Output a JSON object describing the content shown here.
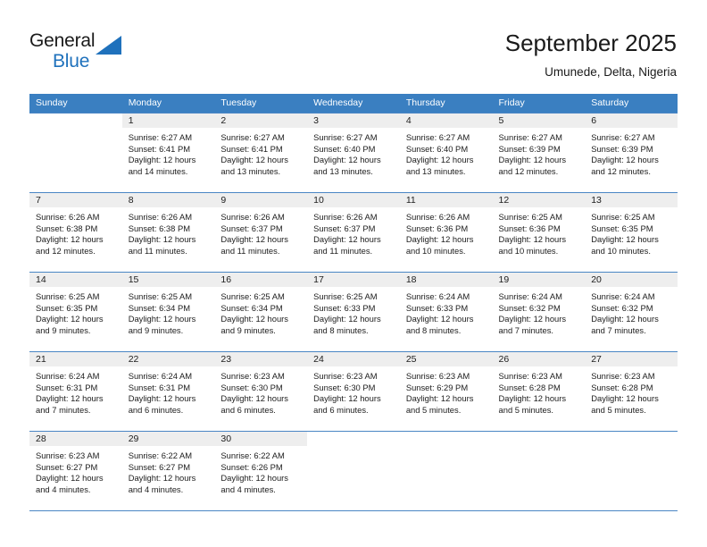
{
  "brand": {
    "name_dark": "General",
    "name_blue": "Blue",
    "accent_color": "#1f71bc"
  },
  "header": {
    "title": "September 2025",
    "subtitle": "Umunede, Delta, Nigeria"
  },
  "theme": {
    "header_band": "#3a7fc1",
    "row_rule": "#4a86c4",
    "daynum_band": "#eeeeee",
    "text": "#202020"
  },
  "weekdays": [
    "Sunday",
    "Monday",
    "Tuesday",
    "Wednesday",
    "Thursday",
    "Friday",
    "Saturday"
  ],
  "weeks": [
    [
      {
        "day": "",
        "sunrise": "",
        "sunset": "",
        "daylight1": "",
        "daylight2": ""
      },
      {
        "day": "1",
        "sunrise": "Sunrise: 6:27 AM",
        "sunset": "Sunset: 6:41 PM",
        "daylight1": "Daylight: 12 hours",
        "daylight2": "and 14 minutes."
      },
      {
        "day": "2",
        "sunrise": "Sunrise: 6:27 AM",
        "sunset": "Sunset: 6:41 PM",
        "daylight1": "Daylight: 12 hours",
        "daylight2": "and 13 minutes."
      },
      {
        "day": "3",
        "sunrise": "Sunrise: 6:27 AM",
        "sunset": "Sunset: 6:40 PM",
        "daylight1": "Daylight: 12 hours",
        "daylight2": "and 13 minutes."
      },
      {
        "day": "4",
        "sunrise": "Sunrise: 6:27 AM",
        "sunset": "Sunset: 6:40 PM",
        "daylight1": "Daylight: 12 hours",
        "daylight2": "and 13 minutes."
      },
      {
        "day": "5",
        "sunrise": "Sunrise: 6:27 AM",
        "sunset": "Sunset: 6:39 PM",
        "daylight1": "Daylight: 12 hours",
        "daylight2": "and 12 minutes."
      },
      {
        "day": "6",
        "sunrise": "Sunrise: 6:27 AM",
        "sunset": "Sunset: 6:39 PM",
        "daylight1": "Daylight: 12 hours",
        "daylight2": "and 12 minutes."
      }
    ],
    [
      {
        "day": "7",
        "sunrise": "Sunrise: 6:26 AM",
        "sunset": "Sunset: 6:38 PM",
        "daylight1": "Daylight: 12 hours",
        "daylight2": "and 12 minutes."
      },
      {
        "day": "8",
        "sunrise": "Sunrise: 6:26 AM",
        "sunset": "Sunset: 6:38 PM",
        "daylight1": "Daylight: 12 hours",
        "daylight2": "and 11 minutes."
      },
      {
        "day": "9",
        "sunrise": "Sunrise: 6:26 AM",
        "sunset": "Sunset: 6:37 PM",
        "daylight1": "Daylight: 12 hours",
        "daylight2": "and 11 minutes."
      },
      {
        "day": "10",
        "sunrise": "Sunrise: 6:26 AM",
        "sunset": "Sunset: 6:37 PM",
        "daylight1": "Daylight: 12 hours",
        "daylight2": "and 11 minutes."
      },
      {
        "day": "11",
        "sunrise": "Sunrise: 6:26 AM",
        "sunset": "Sunset: 6:36 PM",
        "daylight1": "Daylight: 12 hours",
        "daylight2": "and 10 minutes."
      },
      {
        "day": "12",
        "sunrise": "Sunrise: 6:25 AM",
        "sunset": "Sunset: 6:36 PM",
        "daylight1": "Daylight: 12 hours",
        "daylight2": "and 10 minutes."
      },
      {
        "day": "13",
        "sunrise": "Sunrise: 6:25 AM",
        "sunset": "Sunset: 6:35 PM",
        "daylight1": "Daylight: 12 hours",
        "daylight2": "and 10 minutes."
      }
    ],
    [
      {
        "day": "14",
        "sunrise": "Sunrise: 6:25 AM",
        "sunset": "Sunset: 6:35 PM",
        "daylight1": "Daylight: 12 hours",
        "daylight2": "and 9 minutes."
      },
      {
        "day": "15",
        "sunrise": "Sunrise: 6:25 AM",
        "sunset": "Sunset: 6:34 PM",
        "daylight1": "Daylight: 12 hours",
        "daylight2": "and 9 minutes."
      },
      {
        "day": "16",
        "sunrise": "Sunrise: 6:25 AM",
        "sunset": "Sunset: 6:34 PM",
        "daylight1": "Daylight: 12 hours",
        "daylight2": "and 9 minutes."
      },
      {
        "day": "17",
        "sunrise": "Sunrise: 6:25 AM",
        "sunset": "Sunset: 6:33 PM",
        "daylight1": "Daylight: 12 hours",
        "daylight2": "and 8 minutes."
      },
      {
        "day": "18",
        "sunrise": "Sunrise: 6:24 AM",
        "sunset": "Sunset: 6:33 PM",
        "daylight1": "Daylight: 12 hours",
        "daylight2": "and 8 minutes."
      },
      {
        "day": "19",
        "sunrise": "Sunrise: 6:24 AM",
        "sunset": "Sunset: 6:32 PM",
        "daylight1": "Daylight: 12 hours",
        "daylight2": "and 7 minutes."
      },
      {
        "day": "20",
        "sunrise": "Sunrise: 6:24 AM",
        "sunset": "Sunset: 6:32 PM",
        "daylight1": "Daylight: 12 hours",
        "daylight2": "and 7 minutes."
      }
    ],
    [
      {
        "day": "21",
        "sunrise": "Sunrise: 6:24 AM",
        "sunset": "Sunset: 6:31 PM",
        "daylight1": "Daylight: 12 hours",
        "daylight2": "and 7 minutes."
      },
      {
        "day": "22",
        "sunrise": "Sunrise: 6:24 AM",
        "sunset": "Sunset: 6:31 PM",
        "daylight1": "Daylight: 12 hours",
        "daylight2": "and 6 minutes."
      },
      {
        "day": "23",
        "sunrise": "Sunrise: 6:23 AM",
        "sunset": "Sunset: 6:30 PM",
        "daylight1": "Daylight: 12 hours",
        "daylight2": "and 6 minutes."
      },
      {
        "day": "24",
        "sunrise": "Sunrise: 6:23 AM",
        "sunset": "Sunset: 6:30 PM",
        "daylight1": "Daylight: 12 hours",
        "daylight2": "and 6 minutes."
      },
      {
        "day": "25",
        "sunrise": "Sunrise: 6:23 AM",
        "sunset": "Sunset: 6:29 PM",
        "daylight1": "Daylight: 12 hours",
        "daylight2": "and 5 minutes."
      },
      {
        "day": "26",
        "sunrise": "Sunrise: 6:23 AM",
        "sunset": "Sunset: 6:28 PM",
        "daylight1": "Daylight: 12 hours",
        "daylight2": "and 5 minutes."
      },
      {
        "day": "27",
        "sunrise": "Sunrise: 6:23 AM",
        "sunset": "Sunset: 6:28 PM",
        "daylight1": "Daylight: 12 hours",
        "daylight2": "and 5 minutes."
      }
    ],
    [
      {
        "day": "28",
        "sunrise": "Sunrise: 6:23 AM",
        "sunset": "Sunset: 6:27 PM",
        "daylight1": "Daylight: 12 hours",
        "daylight2": "and 4 minutes."
      },
      {
        "day": "29",
        "sunrise": "Sunrise: 6:22 AM",
        "sunset": "Sunset: 6:27 PM",
        "daylight1": "Daylight: 12 hours",
        "daylight2": "and 4 minutes."
      },
      {
        "day": "30",
        "sunrise": "Sunrise: 6:22 AM",
        "sunset": "Sunset: 6:26 PM",
        "daylight1": "Daylight: 12 hours",
        "daylight2": "and 4 minutes."
      },
      {
        "day": "",
        "sunrise": "",
        "sunset": "",
        "daylight1": "",
        "daylight2": ""
      },
      {
        "day": "",
        "sunrise": "",
        "sunset": "",
        "daylight1": "",
        "daylight2": ""
      },
      {
        "day": "",
        "sunrise": "",
        "sunset": "",
        "daylight1": "",
        "daylight2": ""
      },
      {
        "day": "",
        "sunrise": "",
        "sunset": "",
        "daylight1": "",
        "daylight2": ""
      }
    ]
  ]
}
